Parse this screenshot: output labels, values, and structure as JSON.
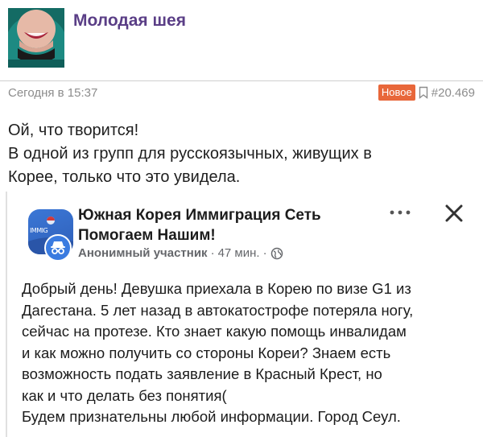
{
  "post": {
    "title": "Молодая шея",
    "timestamp": "Сегодня в 15:37",
    "badge": "Новое",
    "number": "#20.469",
    "thumbnail_icon": "woman-face-thumbnail",
    "text_lines": [
      "Ой, что творится!",
      "В одной из групп для русскоязычных, живущих в",
      "Корее, только что это увидела."
    ]
  },
  "embed": {
    "group_name_lines": [
      "Южная Корея Иммиграция Сеть",
      "Помогаем Нашим!"
    ],
    "avatar_text": "IMMIG",
    "author": "Анонимный участник",
    "time_ago": "47 мин.",
    "separator": "·",
    "icons": {
      "more": "more-dots-icon",
      "close": "close-icon",
      "audience": "globe-icon",
      "anon": "incognito-icon",
      "bookmark": "bookmark-icon"
    },
    "body_lines": [
      "Добрый день! Девушка приехала в Корею по визе G1 из",
      "Дагестана. 5 лет назад в автокатострофе потеряла ногу,",
      "сейчас на протезе. Кто знает какую помощь инвалидам",
      "и как можно получить со стороны Кореи? Знаем есть",
      "возможность подать заявление в Красный Крест, но",
      "как и что делать без понятия(",
      "Будем признательны любой информации. Город Сеул."
    ]
  },
  "colors": {
    "title": "#5a3e86",
    "badge_bg": "#e8673a",
    "meta_text": "#8c8c8c",
    "avatar_blue": "#3b77d6"
  }
}
